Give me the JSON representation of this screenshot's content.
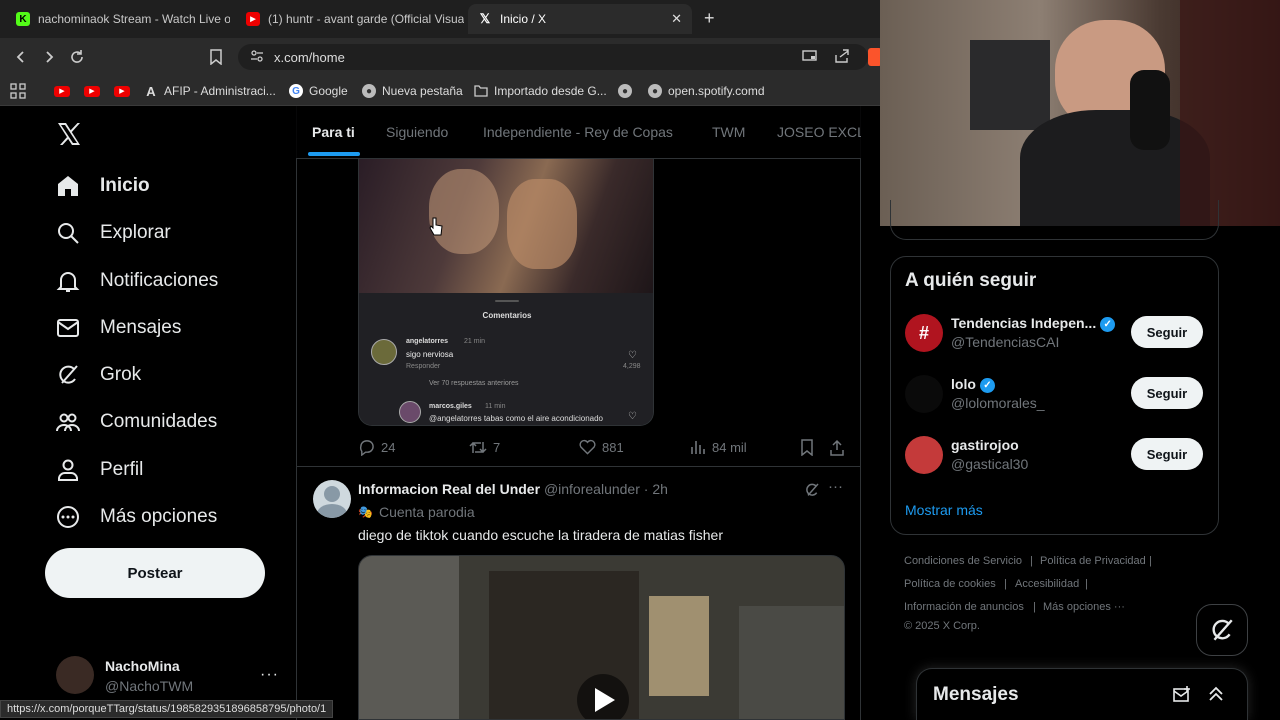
{
  "browser": {
    "tabs": [
      {
        "title": "nachominaok Stream - Watch Live on"
      },
      {
        "title": "(1) huntr - avant garde (Official Visua"
      },
      {
        "title": "Inicio / X"
      }
    ],
    "url": "x.com/home",
    "bookmarks": [
      {
        "label": "AFIP - Administraci..."
      },
      {
        "label": "Google"
      },
      {
        "label": "Nueva pestaña"
      },
      {
        "label": "Importado desde G..."
      },
      {
        "label": "open.spotify.comd"
      }
    ],
    "status_url": "https://x.com/porqueTTarg/status/1985829351896858795/photo/1"
  },
  "nav": {
    "items": [
      {
        "label": "Inicio"
      },
      {
        "label": "Explorar"
      },
      {
        "label": "Notificaciones"
      },
      {
        "label": "Mensajes"
      },
      {
        "label": "Grok"
      },
      {
        "label": "Comunidades"
      },
      {
        "label": "Perfil"
      },
      {
        "label": "Más opciones"
      }
    ],
    "post_label": "Postear",
    "account": {
      "name": "NachoMina",
      "handle": "@NachoTWM"
    }
  },
  "timeline": {
    "tabs": [
      "Para ti",
      "Siguiendo",
      "Independiente - Rey de Copas",
      "TWM",
      "JOSEO EXCL"
    ],
    "post1": {
      "embedded": {
        "header": "Comentarios",
        "c1_user": "angelatorres",
        "c1_time": "21 min",
        "c1_text": "sigo nerviosa",
        "c1_reply": "Responder",
        "c1_likes": "4,298",
        "more_replies": "Ver 70 respuestas anteriores",
        "c2_user": "marcos.giles",
        "c2_time": "11 min",
        "c2_text": "@angelatorres tabas como el aire acondicionado"
      },
      "replies": "24",
      "reposts": "7",
      "likes": "881",
      "views": "84 mil"
    },
    "post2": {
      "name": "Informacion Real del Under",
      "handle": "@inforealunder",
      "time": "· 2h",
      "label": "Cuenta parodia",
      "text": "diego de tiktok cuando escuche la tiradera de matias fisher"
    }
  },
  "sidebar": {
    "who_to_follow_title": "A quién seguir",
    "accounts": [
      {
        "name": "Tendencias Indepen...",
        "handle": "@TendenciasCAI",
        "button": "Seguir"
      },
      {
        "name": "lolo",
        "handle": "@lolomorales_",
        "button": "Seguir"
      },
      {
        "name": "gastirojoo",
        "handle": "@gastical30",
        "button": "Seguir"
      }
    ],
    "show_more": "Mostrar más",
    "footer": [
      "Condiciones de Servicio",
      "|",
      "Política de Privacidad",
      "|",
      "Política de cookies",
      "|",
      "Accesibilidad",
      "|",
      "Información de anuncios",
      "|",
      "Más opciones ···",
      "© 2025 X Corp."
    ],
    "messages_title": "Mensajes"
  },
  "colors": {
    "accent": "#1d9bf0",
    "background": "#000000",
    "muted": "#71767b"
  }
}
